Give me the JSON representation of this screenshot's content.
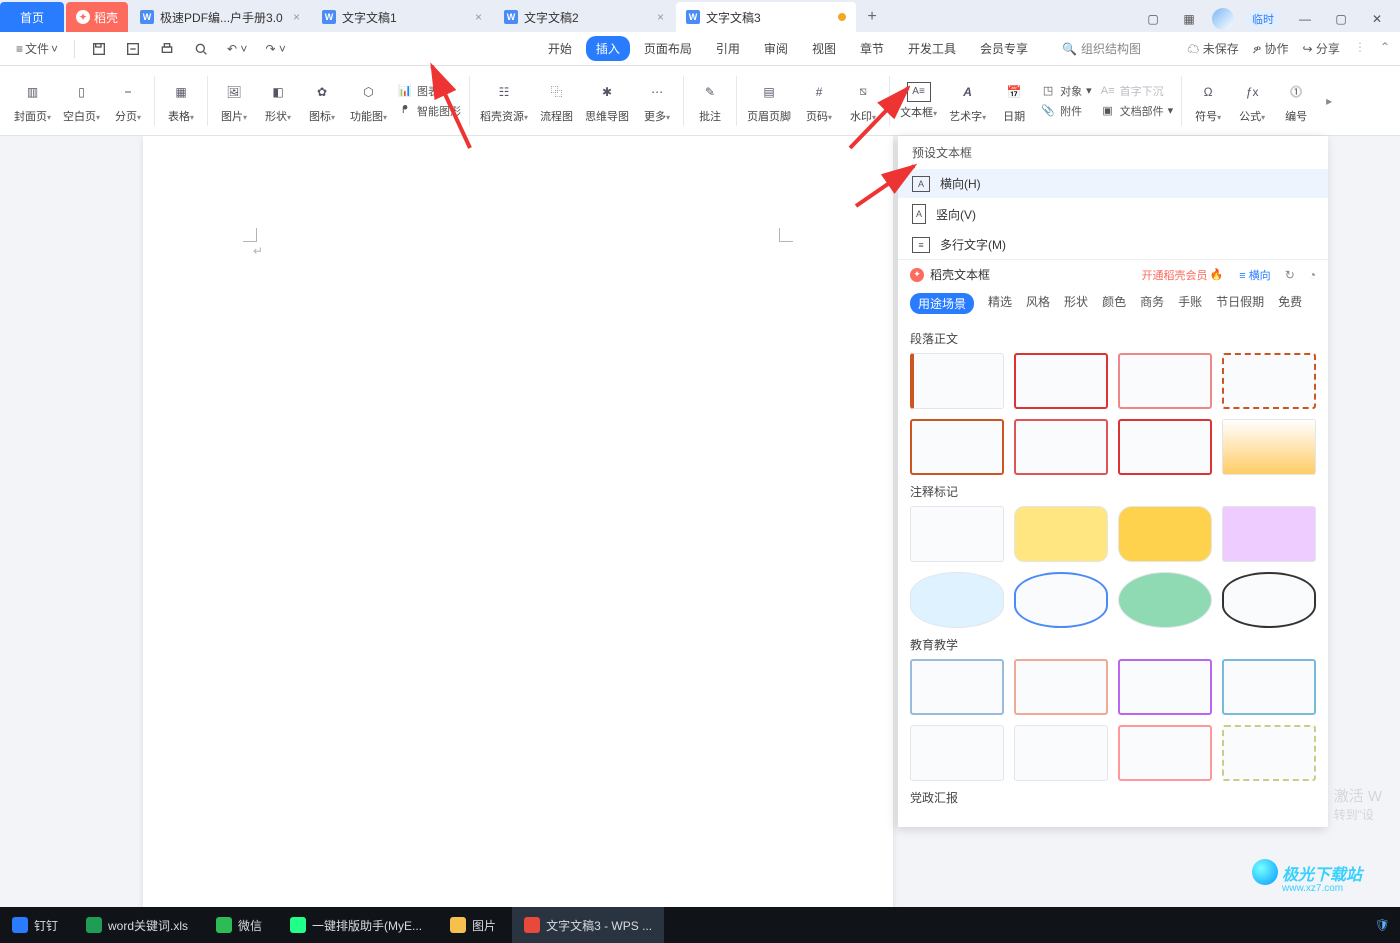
{
  "titlebar": {
    "home": "首页",
    "daoke": "稻壳",
    "tabs": [
      {
        "label": "极速PDF编...户手册3.0"
      },
      {
        "label": "文字文稿1"
      },
      {
        "label": "文字文稿2"
      },
      {
        "label": "文字文稿3",
        "active": true,
        "dirty": true
      }
    ],
    "temp": "临时"
  },
  "quickbar": {
    "file": "文件",
    "menu_tabs": [
      "开始",
      "插入",
      "页面布局",
      "引用",
      "审阅",
      "视图",
      "章节",
      "开发工具",
      "会员专享"
    ],
    "active_menu": "插入",
    "search_placeholder": "组织结构图",
    "actions": {
      "unsaved": "未保存",
      "coop": "协作",
      "share": "分享"
    }
  },
  "ribbon": {
    "items": [
      "封面页",
      "空白页",
      "分页",
      "表格",
      "图片",
      "形状",
      "图标",
      "功能图"
    ],
    "chart": "图表",
    "smartart": "智能图形",
    "res": "稻壳资源",
    "flow": "流程图",
    "mind": "思维导图",
    "more": "更多",
    "comment": "批注",
    "headerfooter": "页眉页脚",
    "pagenum": "页码",
    "watermark": "水印",
    "textbox": "文本框",
    "wordart": "艺术字",
    "date": "日期",
    "attach": "附件",
    "object": "对象",
    "dropcap": "首字下沉",
    "docparts": "文档部件",
    "symbol": "符号",
    "equation": "公式",
    "number": "编号"
  },
  "panel": {
    "preset_title": "预设文本框",
    "opts": {
      "horizontal": "横向(H)",
      "vertical": "竖向(V)",
      "multiline": "多行文字(M)"
    },
    "dk_title": "稻壳文本框",
    "vip": "开通稻壳会员",
    "layout": "横向",
    "cats": [
      "用途场景",
      "精选",
      "风格",
      "形状",
      "颜色",
      "商务",
      "手账",
      "节日假期",
      "免费"
    ],
    "active_cat": "用途场景",
    "groups": [
      "段落正文",
      "注释标记",
      "教育教学",
      "党政汇报"
    ]
  },
  "watermark": {
    "l1": "激活 W",
    "l2": "转到\"设"
  },
  "taskbar": {
    "items": [
      {
        "label": "钉钉",
        "cls": "dd"
      },
      {
        "label": "word关键词.xls",
        "cls": "xls"
      },
      {
        "label": "微信",
        "cls": "wx"
      },
      {
        "label": "一键排版助手(MyE...",
        "cls": "py"
      },
      {
        "label": "图片",
        "cls": "folder"
      },
      {
        "label": "文字文稿3 - WPS ...",
        "cls": "wps",
        "active": true
      }
    ]
  },
  "logo": {
    "t1": "极光下载站",
    "t2": "www.xz7.com"
  }
}
